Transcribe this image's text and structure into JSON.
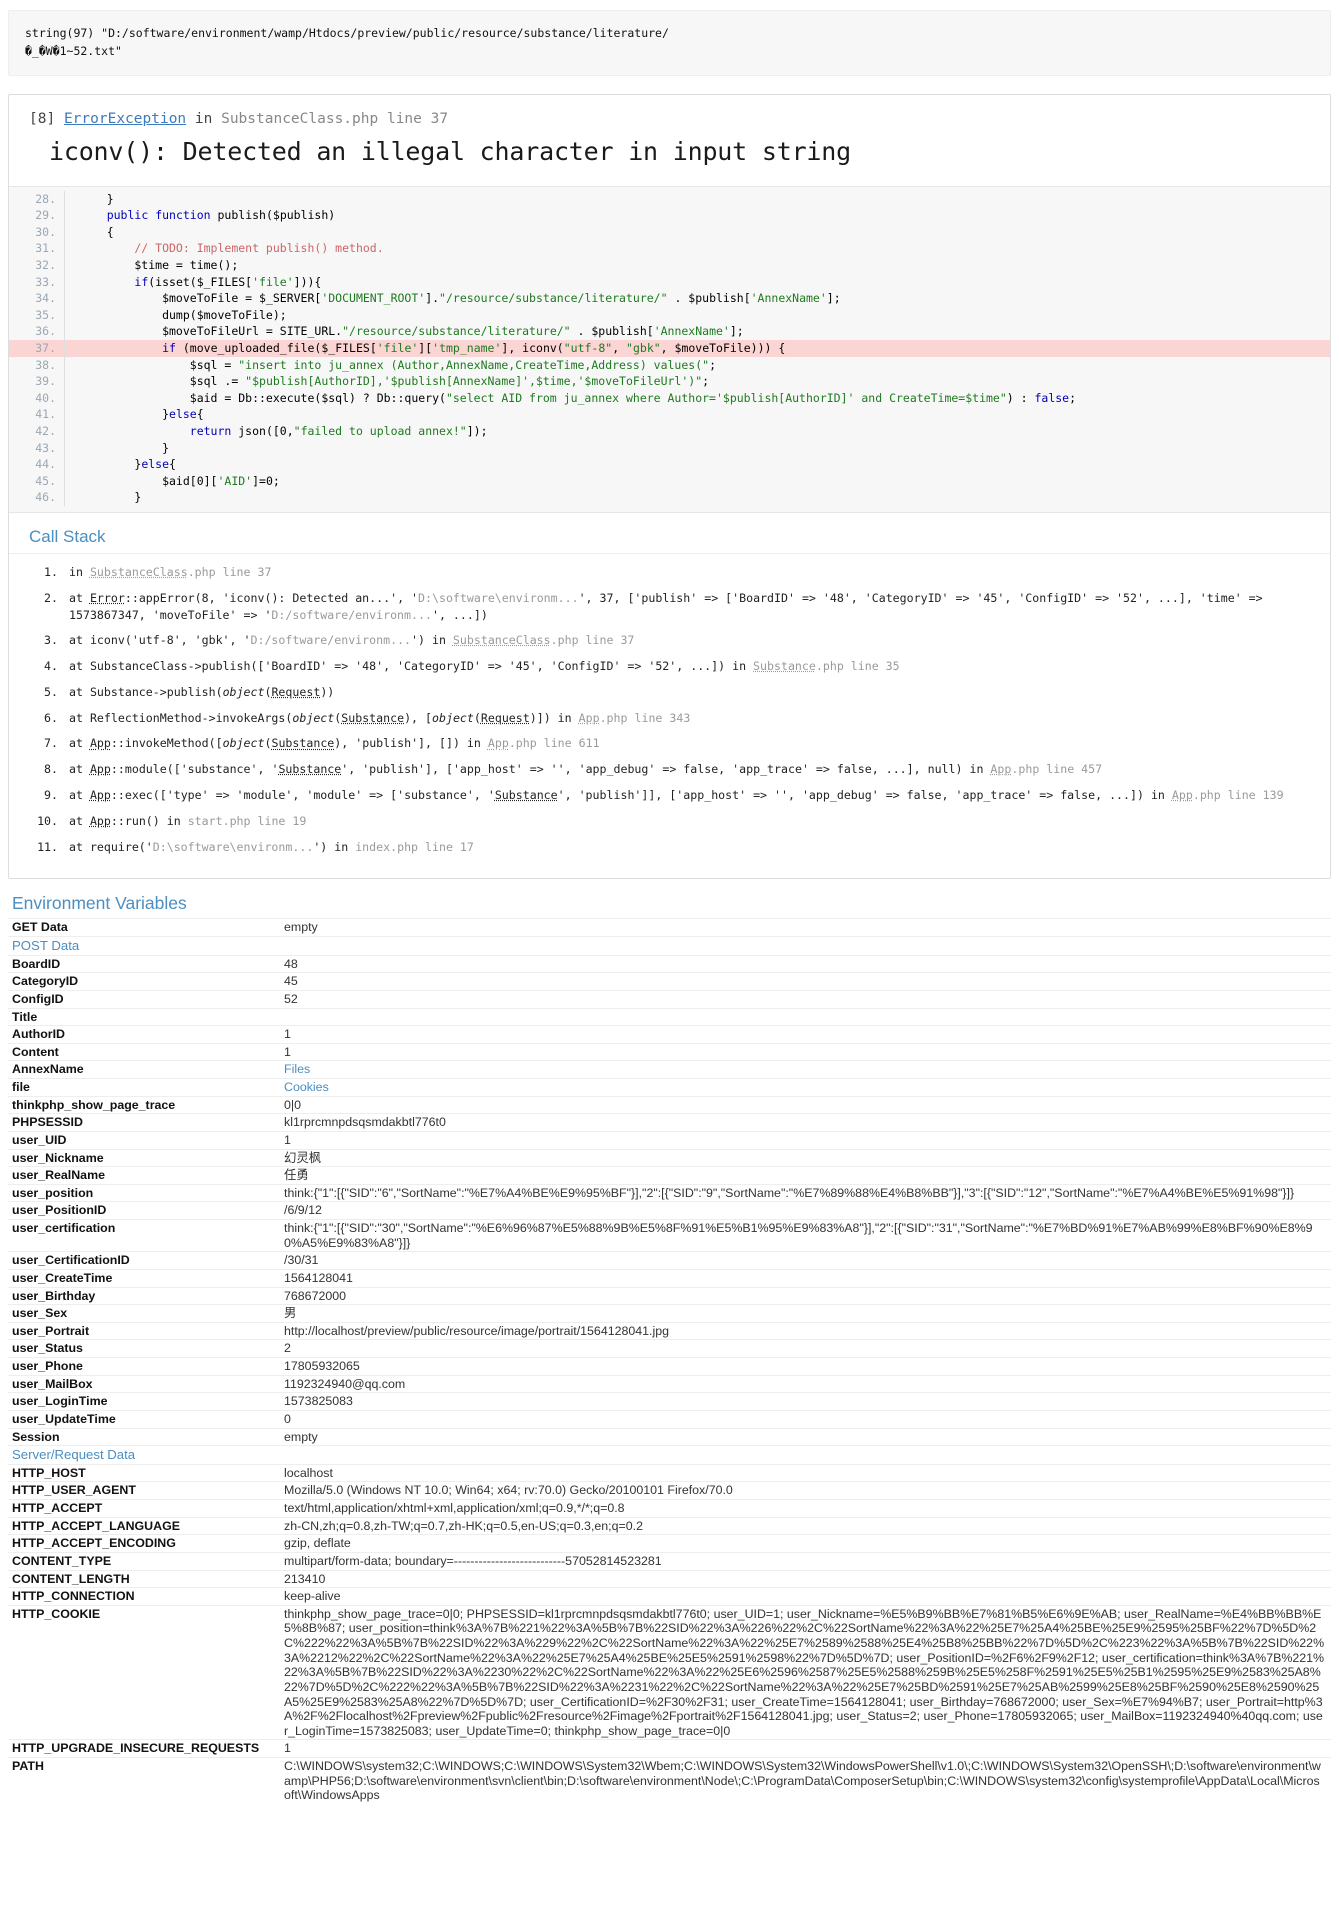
{
  "dump": {
    "text": "string(97) \"D:/software/environment/wamp/Htdocs/preview/public/resource/substance/literature/\n�_�W�1~52.txt\""
  },
  "exception": {
    "code": "[8]",
    "type": "ErrorException",
    "in": "in",
    "file": "SubstanceClass.php line 37",
    "message": "iconv(): Detected an illegal character in input string"
  },
  "source": {
    "highlight_line": 37,
    "lines": [
      {
        "num": "28.",
        "code": "    }"
      },
      {
        "num": "29.",
        "code": "    public function publish($publish)"
      },
      {
        "num": "30.",
        "code": "    {"
      },
      {
        "num": "31.",
        "code": "        // TODO: Implement publish() method."
      },
      {
        "num": "32.",
        "code": "        $time = time();"
      },
      {
        "num": "33.",
        "code": "        if(isset($_FILES['file'])){"
      },
      {
        "num": "34.",
        "code": "            $moveToFile = $_SERVER['DOCUMENT_ROOT'].\"/resource/substance/literature/\" . $publish['AnnexName'];"
      },
      {
        "num": "35.",
        "code": "            dump($moveToFile);"
      },
      {
        "num": "36.",
        "code": "            $moveToFileUrl = SITE_URL.\"/resource/substance/literature/\" . $publish['AnnexName'];"
      },
      {
        "num": "37.",
        "code": "            if (move_uploaded_file($_FILES['file']['tmp_name'], iconv(\"utf-8\", \"gbk\", $moveToFile))) {"
      },
      {
        "num": "38.",
        "code": "                $sql = \"insert into ju_annex (Author,AnnexName,CreateTime,Address) values(\";"
      },
      {
        "num": "39.",
        "code": "                $sql .= \"$publish[AuthorID],'$publish[AnnexName]',$time,'$moveToFileUrl')\";"
      },
      {
        "num": "40.",
        "code": "                $aid = Db::execute($sql) ? Db::query(\"select AID from ju_annex where Author='$publish[AuthorID]' and CreateTime=$time\") : false;"
      },
      {
        "num": "41.",
        "code": "            }else{"
      },
      {
        "num": "42.",
        "code": "                return json([0,\"failed to upload annex!\"]);"
      },
      {
        "num": "43.",
        "code": "            }"
      },
      {
        "num": "44.",
        "code": "        }else{"
      },
      {
        "num": "45.",
        "code": "            $aid[0]['AID']=0;"
      },
      {
        "num": "46.",
        "code": "        }"
      }
    ]
  },
  "call_stack": {
    "title": "Call Stack",
    "items": [
      "in SubstanceClass.php line 37",
      "at Error::appError(8, 'iconv(): Detected an...', 'D:\\software\\environm...', 37, ['publish' => ['BoardID' => '48', 'CategoryID' => '45', 'ConfigID' => '52', ...], 'time' => 1573867347, 'moveToFile' => 'D:/software/environm...', ...])",
      "at iconv('utf-8', 'gbk', 'D:/software/environm...') in SubstanceClass.php line 37",
      "at SubstanceClass->publish(['BoardID' => '48', 'CategoryID' => '45', 'ConfigID' => '52', ...]) in Substance.php line 35",
      "at Substance->publish(object(Request))",
      "at ReflectionMethod->invokeArgs(object(Substance), [object(Request)]) in App.php line 343",
      "at App::invokeMethod([object(Substance), 'publish'], []) in App.php line 611",
      "at App::module(['substance', 'Substance', 'publish'], ['app_host' => '', 'app_debug' => false, 'app_trace' => false, ...], null) in App.php line 457",
      "at App::exec(['type' => 'module', 'module' => ['substance', 'Substance', 'publish']], ['app_host' => '', 'app_debug' => false, 'app_trace' => false, ...]) in App.php line 139",
      "at App::run() in start.php line 19",
      "at require('D:\\software\\environm...') in index.php line 17"
    ]
  },
  "environment": {
    "title": "Environment Variables",
    "rows": [
      {
        "key": "GET Data",
        "value": "empty",
        "type": "row"
      },
      {
        "key": "POST Data",
        "value": "",
        "type": "section"
      },
      {
        "key": "BoardID",
        "value": "48",
        "type": "row"
      },
      {
        "key": "CategoryID",
        "value": "45",
        "type": "row"
      },
      {
        "key": "ConfigID",
        "value": "52",
        "type": "row"
      },
      {
        "key": "Title",
        "value": "",
        "type": "row"
      },
      {
        "key": "AuthorID",
        "value": "1",
        "type": "row"
      },
      {
        "key": "Content",
        "value": "1",
        "type": "row"
      },
      {
        "key": "AnnexName",
        "value": "Files",
        "type": "link"
      },
      {
        "key": "file",
        "value": "Cookies",
        "type": "link"
      },
      {
        "key": "thinkphp_show_page_trace",
        "value": "0|0",
        "type": "row"
      },
      {
        "key": "PHPSESSID",
        "value": "kl1rprcmnpdsqsmdakbtl776t0",
        "type": "row"
      },
      {
        "key": "user_UID",
        "value": "1",
        "type": "row"
      },
      {
        "key": "user_Nickname",
        "value": "幻灵枫",
        "type": "row"
      },
      {
        "key": "user_RealName",
        "value": "任勇",
        "type": "row"
      },
      {
        "key": "user_position",
        "value": "think:{\"1\":[{\"SID\":\"6\",\"SortName\":\"%E7%A4%BE%E9%95%BF\"}],\"2\":[{\"SID\":\"9\",\"SortName\":\"%E7%89%88%E4%B8%BB\"}],\"3\":[{\"SID\":\"12\",\"SortName\":\"%E7%A4%BE%E5%91%98\"}]}",
        "type": "row"
      },
      {
        "key": "user_PositionID",
        "value": "/6/9/12",
        "type": "row"
      },
      {
        "key": "user_certification",
        "value": "think:{\"1\":[{\"SID\":\"30\",\"SortName\":\"%E6%96%87%E5%88%9B%E5%8F%91%E5%B1%95%E9%83%A8\"}],\"2\":[{\"SID\":\"31\",\"SortName\":\"%E7%BD%91%E7%AB%99%E8%BF%90%E8%90%A5%E9%83%A8\"}]}",
        "type": "row"
      },
      {
        "key": "user_CertificationID",
        "value": "/30/31",
        "type": "row"
      },
      {
        "key": "user_CreateTime",
        "value": "1564128041",
        "type": "row"
      },
      {
        "key": "user_Birthday",
        "value": "768672000",
        "type": "row"
      },
      {
        "key": "user_Sex",
        "value": "男",
        "type": "row"
      },
      {
        "key": "user_Portrait",
        "value": "http://localhost/preview/public/resource/image/portrait/1564128041.jpg",
        "type": "row"
      },
      {
        "key": "user_Status",
        "value": "2",
        "type": "row"
      },
      {
        "key": "user_Phone",
        "value": "17805932065",
        "type": "row"
      },
      {
        "key": "user_MailBox",
        "value": "1192324940@qq.com",
        "type": "row"
      },
      {
        "key": "user_LoginTime",
        "value": "1573825083",
        "type": "row"
      },
      {
        "key": "user_UpdateTime",
        "value": "0",
        "type": "row"
      },
      {
        "key": "Session",
        "value": "empty",
        "type": "row"
      },
      {
        "key": "Server/Request Data",
        "value": "",
        "type": "section"
      },
      {
        "key": "HTTP_HOST",
        "value": "localhost",
        "type": "row"
      },
      {
        "key": "HTTP_USER_AGENT",
        "value": "Mozilla/5.0 (Windows NT 10.0; Win64; x64; rv:70.0) Gecko/20100101 Firefox/70.0",
        "type": "row"
      },
      {
        "key": "HTTP_ACCEPT",
        "value": "text/html,application/xhtml+xml,application/xml;q=0.9,*/*;q=0.8",
        "type": "row"
      },
      {
        "key": "HTTP_ACCEPT_LANGUAGE",
        "value": "zh-CN,zh;q=0.8,zh-TW;q=0.7,zh-HK;q=0.5,en-US;q=0.3,en;q=0.2",
        "type": "row"
      },
      {
        "key": "HTTP_ACCEPT_ENCODING",
        "value": "gzip, deflate",
        "type": "row"
      },
      {
        "key": "CONTENT_TYPE",
        "value": "multipart/form-data; boundary=---------------------------57052814523281",
        "type": "row"
      },
      {
        "key": "CONTENT_LENGTH",
        "value": "213410",
        "type": "row"
      },
      {
        "key": "HTTP_CONNECTION",
        "value": "keep-alive",
        "type": "row"
      },
      {
        "key": "HTTP_COOKIE",
        "value": "thinkphp_show_page_trace=0|0; PHPSESSID=kl1rprcmnpdsqsmdakbtl776t0; user_UID=1; user_Nickname=%E5%B9%BB%E7%81%B5%E6%9E%AB; user_RealName=%E4%BB%BB%E5%8B%87; user_position=think%3A%7B%221%22%3A%5B%7B%22SID%22%3A%226%22%2C%22SortName%22%3A%22%25E7%25A4%25BE%25E9%2595%25BF%22%7D%5D%2C%222%22%3A%5B%7B%22SID%22%3A%229%22%2C%22SortName%22%3A%22%25E7%2589%2588%25E4%25B8%25BB%22%7D%5D%2C%223%22%3A%5B%7B%22SID%22%3A%2212%22%2C%22SortName%22%3A%22%25E7%25A4%25BE%25E5%2591%2598%22%7D%5D%7D; user_PositionID=%2F6%2F9%2F12; user_certification=think%3A%7B%221%22%3A%5B%7B%22SID%22%3A%2230%22%2C%22SortName%22%3A%22%25E6%2596%2587%25E5%2588%259B%25E5%258F%2591%25E5%25B1%2595%25E9%2583%25A8%22%7D%5D%2C%222%22%3A%5B%7B%22SID%22%3A%2231%22%2C%22SortName%22%3A%22%25E7%25BD%2591%25E7%25AB%2599%25E8%25BF%2590%25E8%2590%25A5%25E9%2583%25A8%22%7D%5D%7D; user_CertificationID=%2F30%2F31; user_CreateTime=1564128041; user_Birthday=768672000; user_Sex=%E7%94%B7; user_Portrait=http%3A%2F%2Flocalhost%2Fpreview%2Fpublic%2Fresource%2Fimage%2Fportrait%2F1564128041.jpg; user_Status=2; user_Phone=17805932065; user_MailBox=1192324940%40qq.com; user_LoginTime=1573825083; user_UpdateTime=0; thinkphp_show_page_trace=0|0",
        "type": "row"
      },
      {
        "key": "HTTP_UPGRADE_INSECURE_REQUESTS",
        "value": "1",
        "type": "row"
      },
      {
        "key": "PATH",
        "value": "C:\\WINDOWS\\system32;C:\\WINDOWS;C:\\WINDOWS\\System32\\Wbem;C:\\WINDOWS\\System32\\WindowsPowerShell\\v1.0\\;C:\\WINDOWS\\System32\\OpenSSH\\;D:\\software\\environment\\wamp\\PHP56;D:\\software\\environment\\svn\\client\\bin;D:\\software\\environment\\Node\\;C:\\ProgramData\\ComposerSetup\\bin;C:\\WINDOWS\\system32\\config\\systemprofile\\AppData\\Local\\Microsoft\\WindowsApps",
        "type": "row"
      }
    ]
  },
  "colors": {
    "accent": "#4a8ec2",
    "highlight": "#fbd4d4",
    "string": "#1f7a1f",
    "keyword": "#0000bb",
    "comment": "#cc6666"
  }
}
